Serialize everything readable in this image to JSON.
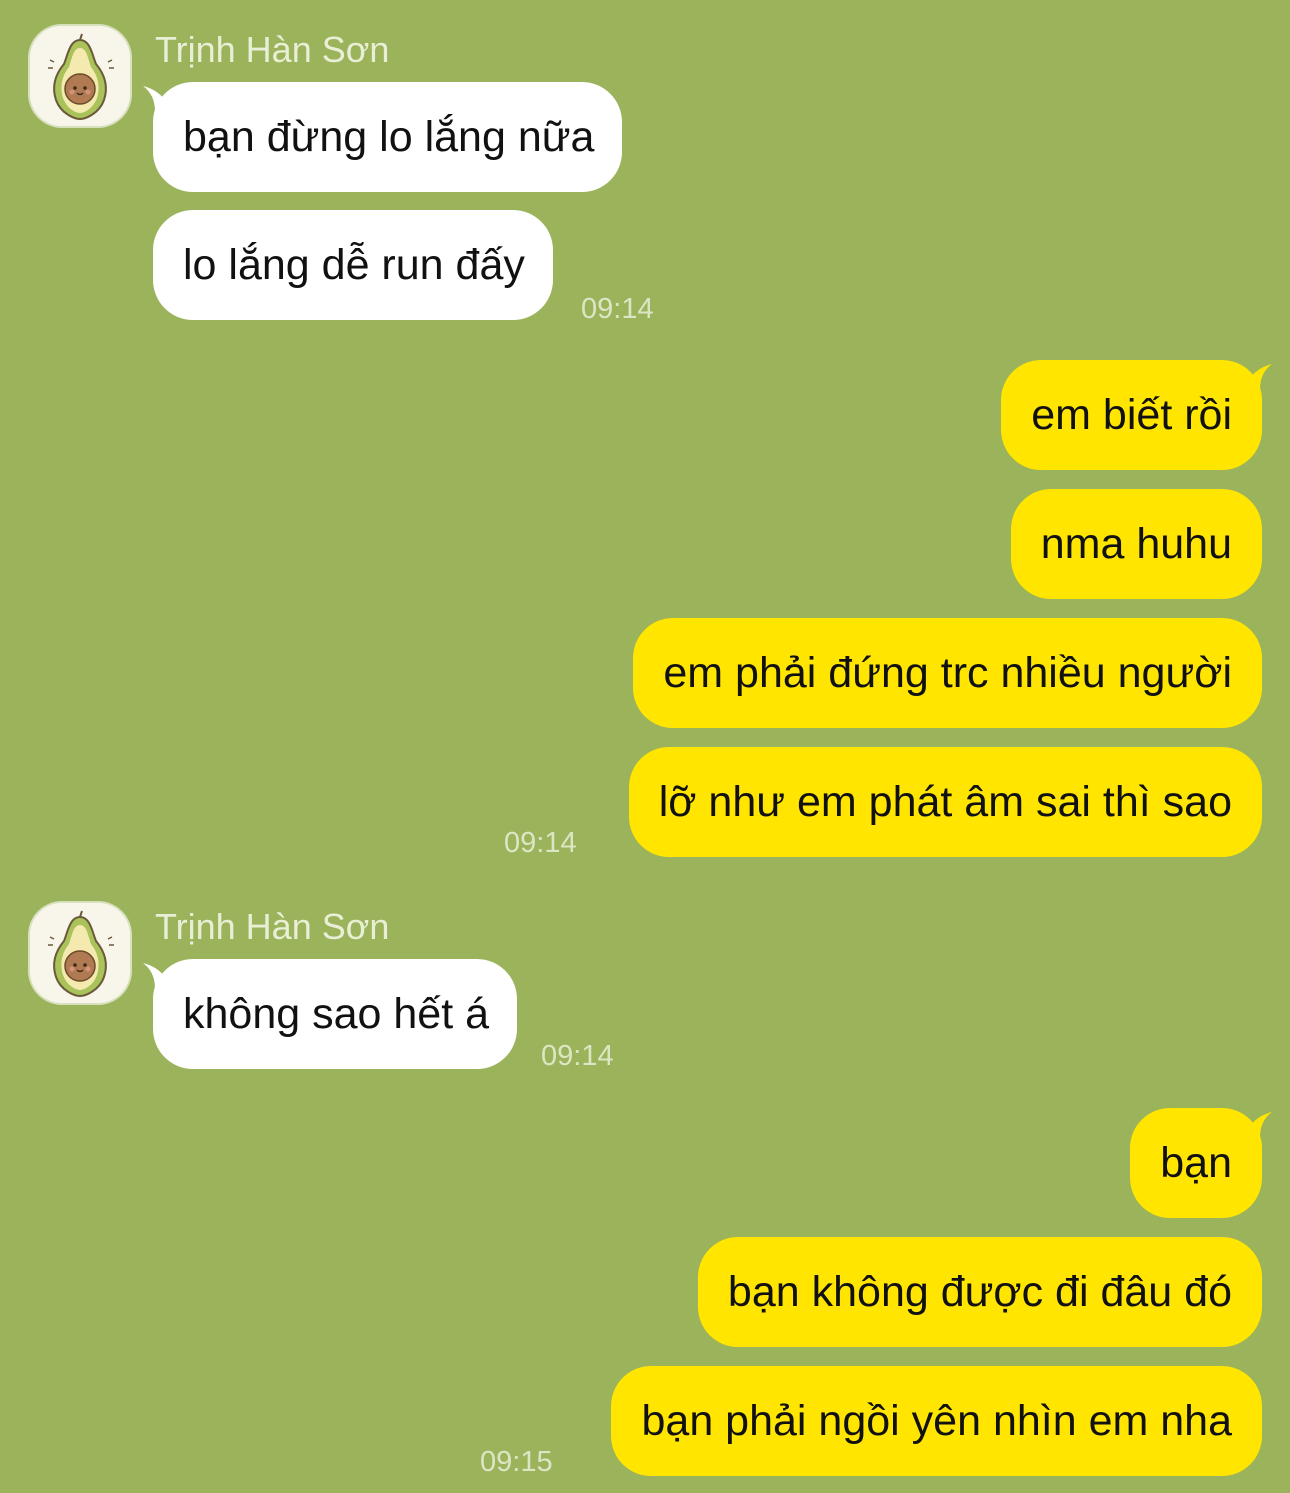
{
  "colors": {
    "background": "#9bb35a",
    "incoming_bubble": "#ffffff",
    "outgoing_bubble": "#ffe500",
    "timestamp": "#dde6c4"
  },
  "groups": [
    {
      "direction": "incoming",
      "sender": "Trịnh Hàn Sơn",
      "avatar_icon": "avocado-avatar-icon",
      "messages": [
        "bạn đừng lo lắng nữa",
        "lo lắng dễ run đấy"
      ],
      "time": "09:14"
    },
    {
      "direction": "outgoing",
      "messages": [
        "em biết rồi",
        "nma huhu",
        "em phải đứng trc nhiều người",
        "lỡ như em phát âm sai thì sao"
      ],
      "time": "09:14"
    },
    {
      "direction": "incoming",
      "sender": "Trịnh Hàn Sơn",
      "avatar_icon": "avocado-avatar-icon",
      "messages": [
        "không sao hết á"
      ],
      "time": "09:14"
    },
    {
      "direction": "outgoing",
      "messages": [
        "bạn",
        "bạn không được đi đâu đó",
        "bạn phải ngồi yên nhìn em nha"
      ],
      "time": "09:15"
    }
  ]
}
